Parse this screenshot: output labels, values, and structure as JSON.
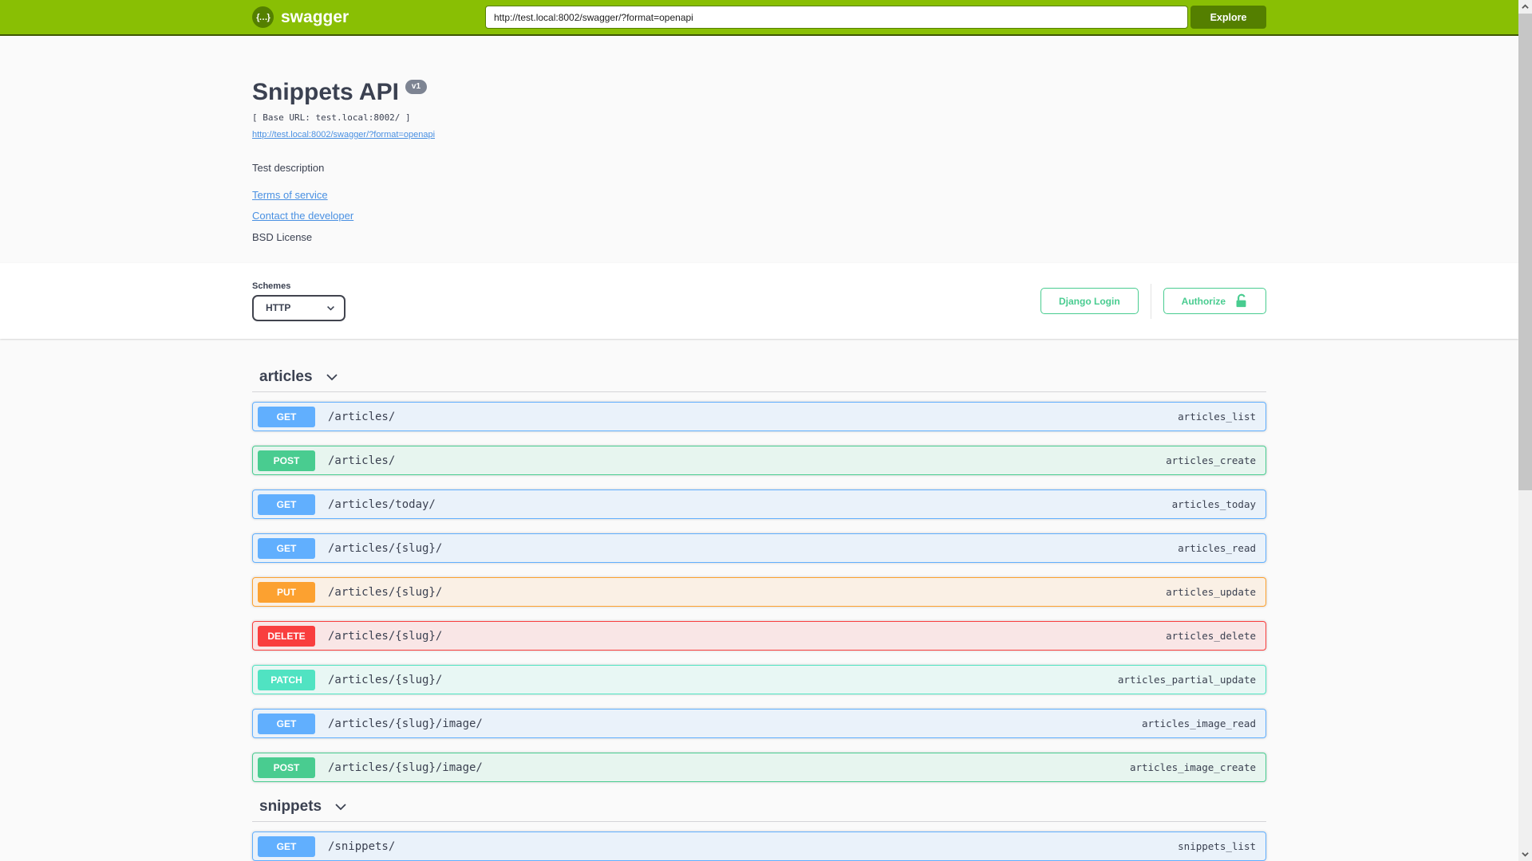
{
  "topbar": {
    "brand": "swagger",
    "logo_glyph": "{…}",
    "url_value": "http://test.local:8002/swagger/?format=openapi",
    "explore_label": "Explore"
  },
  "info": {
    "title": "Snippets API",
    "version_badge": "v1",
    "base_url_line": "[ Base URL: test.local:8002/ ]",
    "spec_link": "http://test.local:8002/swagger/?format=openapi",
    "description": "Test description",
    "terms_link": "Terms of service",
    "contact_link": "Contact the developer",
    "license": "BSD License"
  },
  "scheme": {
    "label": "Schemes",
    "selected": "HTTP",
    "django_login_label": "Django Login",
    "authorize_label": "Authorize"
  },
  "colors": {
    "topbar_green": "#89bf04",
    "dark_green": "#547f00",
    "auth_green": "#49cc90",
    "get_blue": "#61affe",
    "post_green": "#49cc90",
    "put_orange": "#fca130",
    "delete_red": "#f93e3e",
    "patch_teal": "#50e3c2",
    "text": "#3b4151",
    "link_blue": "#4990e2",
    "version_badge_gray": "#7d8492"
  },
  "sections": [
    {
      "name": "articles",
      "endpoints": [
        {
          "method": "GET",
          "path": "/articles/",
          "operation_id": "articles_list"
        },
        {
          "method": "POST",
          "path": "/articles/",
          "operation_id": "articles_create"
        },
        {
          "method": "GET",
          "path": "/articles/today/",
          "operation_id": "articles_today"
        },
        {
          "method": "GET",
          "path": "/articles/{slug}/",
          "operation_id": "articles_read"
        },
        {
          "method": "PUT",
          "path": "/articles/{slug}/",
          "operation_id": "articles_update"
        },
        {
          "method": "DELETE",
          "path": "/articles/{slug}/",
          "operation_id": "articles_delete"
        },
        {
          "method": "PATCH",
          "path": "/articles/{slug}/",
          "operation_id": "articles_partial_update"
        },
        {
          "method": "GET",
          "path": "/articles/{slug}/image/",
          "operation_id": "articles_image_read"
        },
        {
          "method": "POST",
          "path": "/articles/{slug}/image/",
          "operation_id": "articles_image_create"
        }
      ]
    },
    {
      "name": "snippets",
      "endpoints": [
        {
          "method": "GET",
          "path": "/snippets/",
          "operation_id": "snippets_list"
        }
      ]
    }
  ]
}
